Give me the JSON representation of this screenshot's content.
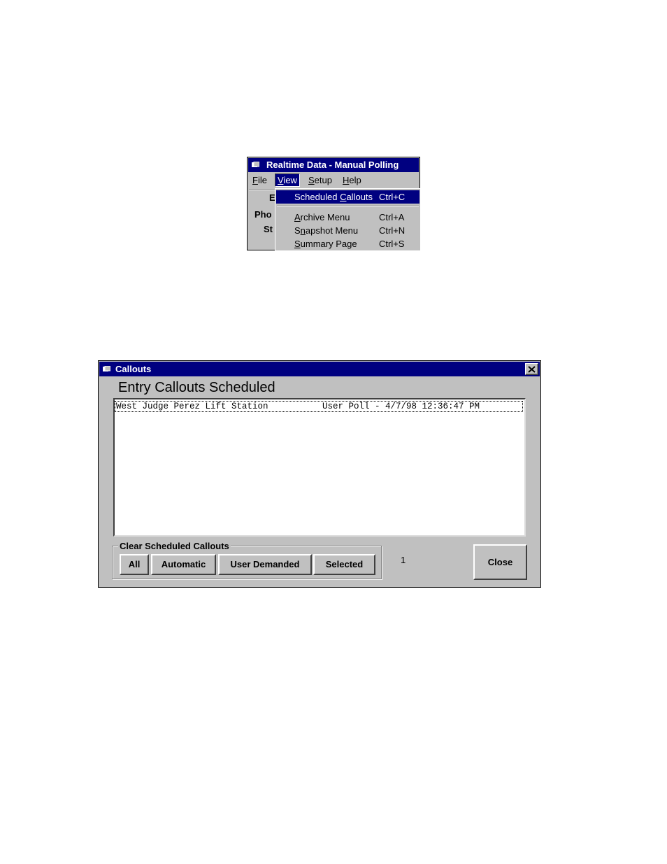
{
  "menu_window": {
    "title": "Realtime Data - Manual Polling",
    "menubar": [
      {
        "label": "File",
        "mnemonic": "F",
        "rest": "ile"
      },
      {
        "label": "View",
        "mnemonic": "V",
        "rest": "iew"
      },
      {
        "label": "Setup",
        "mnemonic": "S",
        "rest": "etup"
      },
      {
        "label": "Help",
        "mnemonic": "H",
        "rest": "elp"
      }
    ],
    "behind_fragments": [
      "E",
      "Pho",
      "St"
    ],
    "view_menu": [
      {
        "pre": "Scheduled ",
        "mnemonic": "C",
        "post": "allouts",
        "shortcut": "Ctrl+C"
      },
      {
        "pre": "",
        "mnemonic": "A",
        "post": "rchive Menu",
        "shortcut": "Ctrl+A"
      },
      {
        "pre": "S",
        "mnemonic": "n",
        "post": "apshot Menu",
        "shortcut": "Ctrl+N"
      },
      {
        "pre": "",
        "mnemonic": "S",
        "post": "ummary Page",
        "shortcut": "Ctrl+S"
      }
    ]
  },
  "callouts_window": {
    "title": "Callouts",
    "heading": "Entry Callouts Scheduled",
    "list_items": [
      {
        "station": "West Judge Perez Lift Station",
        "info": "User Poll - 4/7/98 12:36:47 PM"
      }
    ],
    "group_label": "Clear Scheduled Callouts",
    "buttons": {
      "all": "All",
      "automatic": "Automatic",
      "user_demanded": "User Demanded",
      "selected": "Selected"
    },
    "count": "1",
    "close_label": "Close"
  },
  "colors": {
    "titlebar": "#000080",
    "face": "#c0c0c0",
    "highlight": "#000080"
  }
}
